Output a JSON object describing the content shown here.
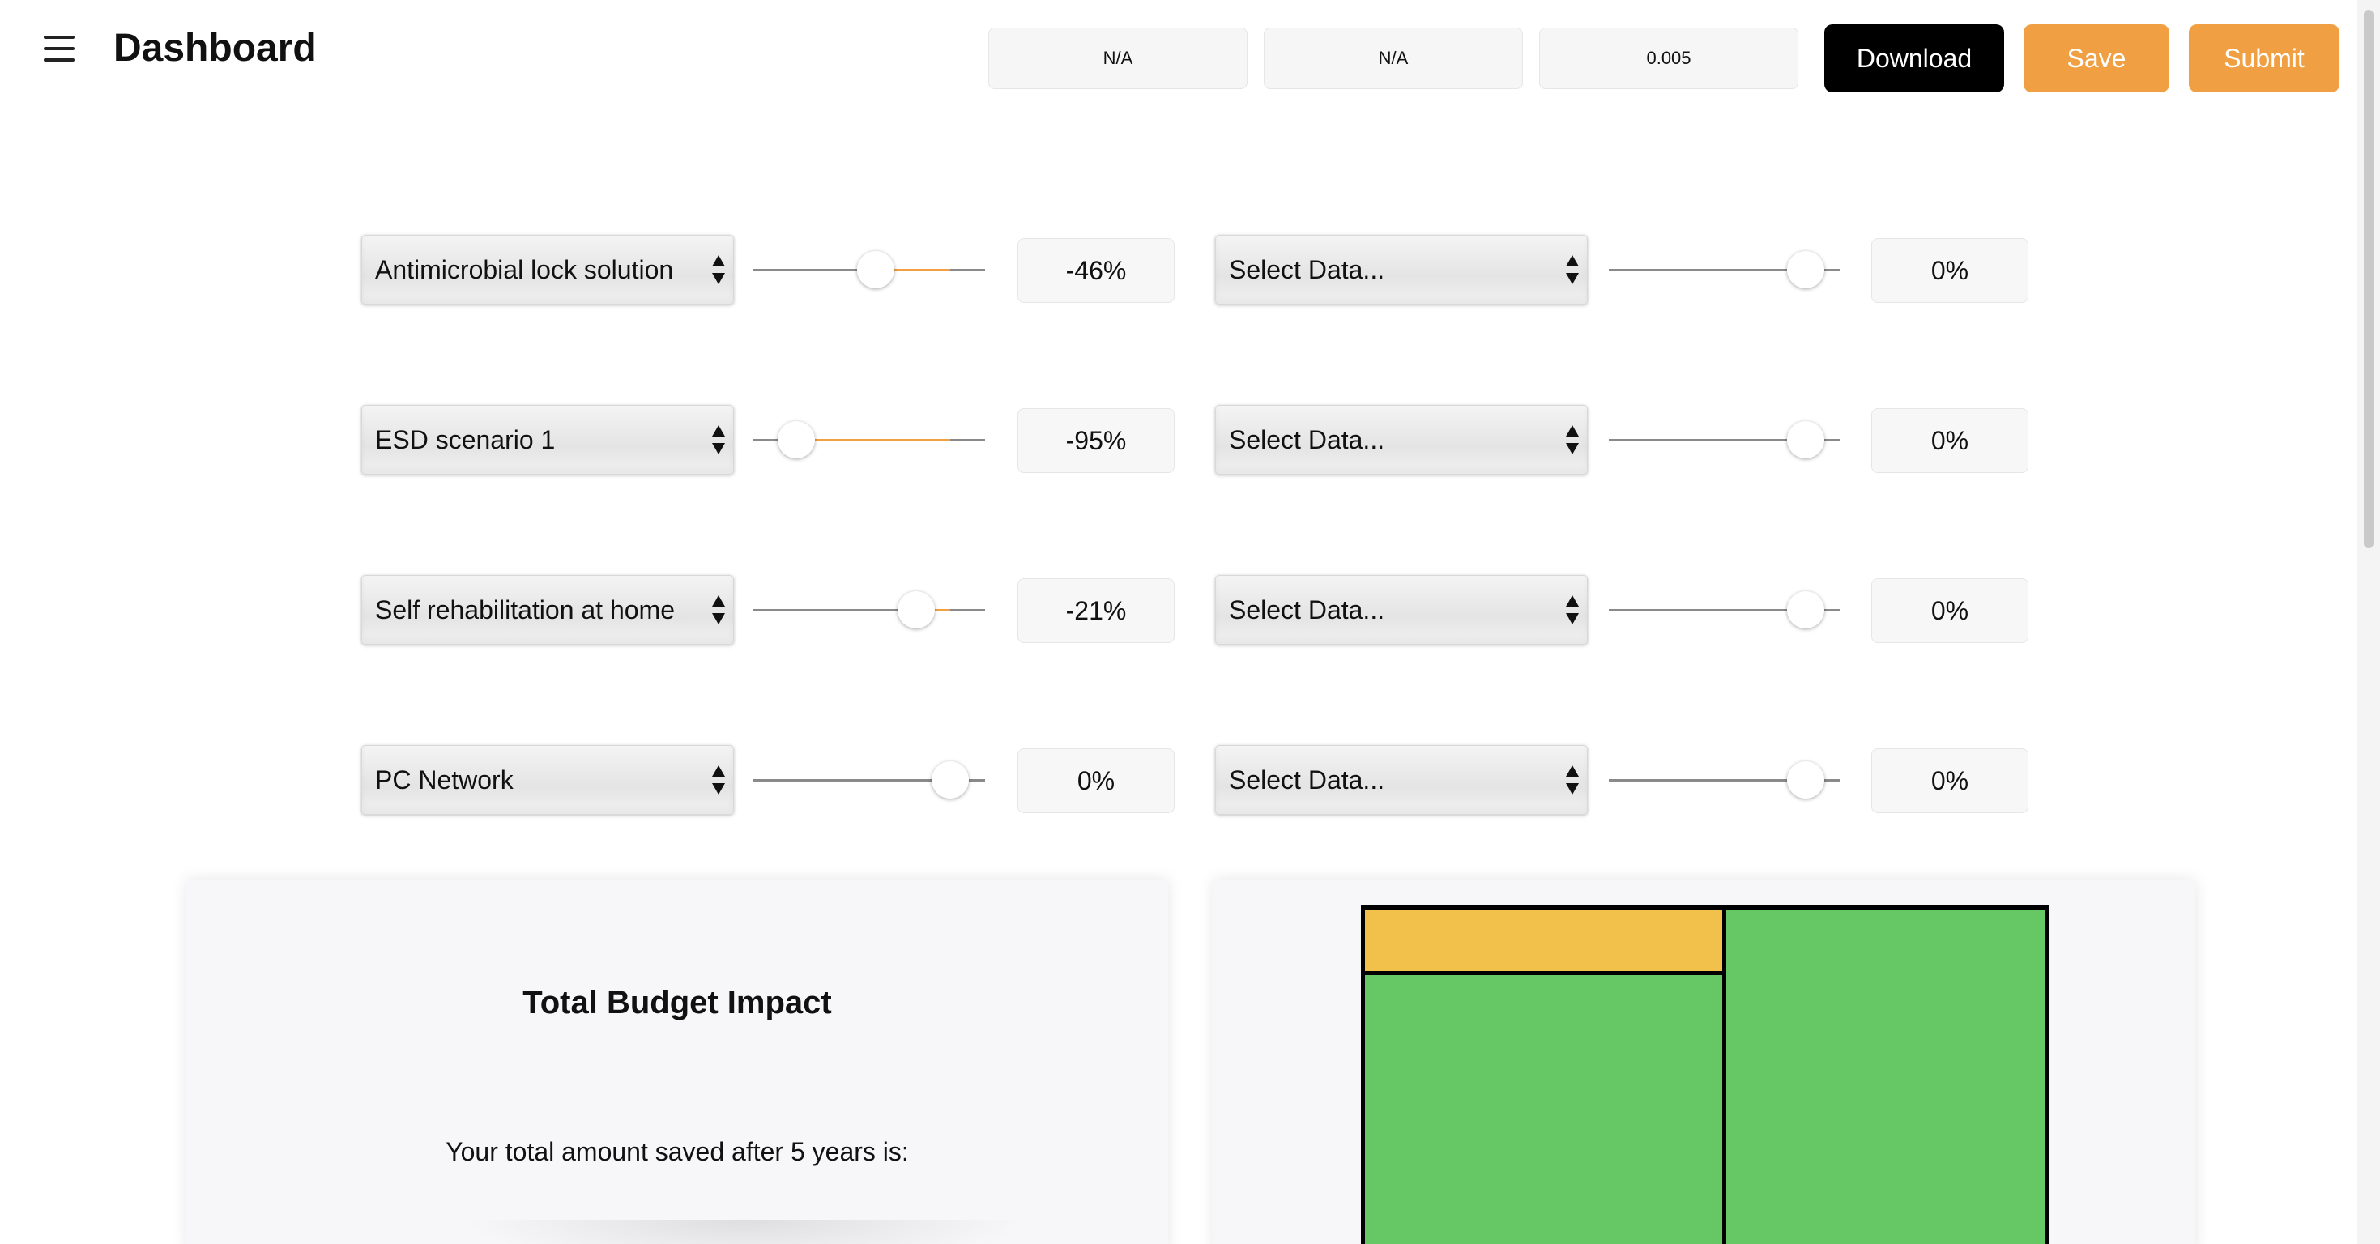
{
  "header": {
    "title": "Dashboard",
    "menu_icon": "hamburger-menu-icon",
    "info_boxes": [
      "N/A",
      "N/A",
      "0.005"
    ],
    "download_label": "Download",
    "save_label": "Save",
    "submit_label": "Submit"
  },
  "colors": {
    "accent": "#f0a043",
    "dark_button": "#000000",
    "treemap_yellow": "#f2c14b",
    "treemap_green": "#66c864"
  },
  "scenarios": [
    {
      "name": "Antimicrobial lock solution",
      "value": -46,
      "display": "-46%"
    },
    {
      "name": "ESD scenario 1",
      "value": -95,
      "display": "-95%"
    },
    {
      "name": "Self rehabilitation at home",
      "value": -21,
      "display": "-21%"
    },
    {
      "name": "PC Network",
      "value": 0,
      "display": "0%"
    }
  ],
  "secondary": [
    {
      "placeholder": "Select Data...",
      "value": 0,
      "display": "0%"
    },
    {
      "placeholder": "Select Data...",
      "value": 0,
      "display": "0%"
    },
    {
      "placeholder": "Select Data...",
      "value": 0,
      "display": "0%"
    },
    {
      "placeholder": "Select Data...",
      "value": 0,
      "display": "0%"
    }
  ],
  "budget_panel": {
    "title": "Total Budget Impact",
    "text": "Your total amount saved after 5 years is:"
  }
}
